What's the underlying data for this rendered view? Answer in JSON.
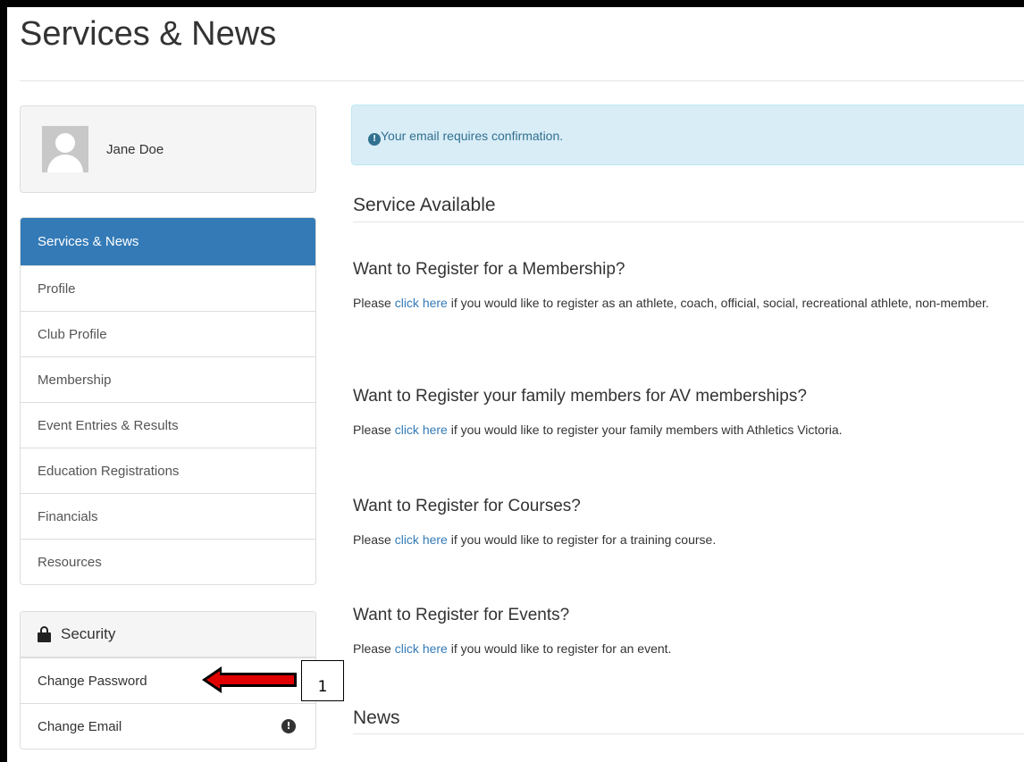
{
  "page_title": "Services & News",
  "user": {
    "name": "Jane Doe"
  },
  "nav": {
    "items": [
      {
        "label": "Services & News",
        "active": true
      },
      {
        "label": "Profile"
      },
      {
        "label": "Club Profile"
      },
      {
        "label": "Membership"
      },
      {
        "label": "Event Entries & Results"
      },
      {
        "label": "Education Registrations"
      },
      {
        "label": "Financials"
      },
      {
        "label": "Resources"
      }
    ]
  },
  "security": {
    "heading": "Security",
    "icon": "lock-icon",
    "items": [
      {
        "label": "Change Password"
      },
      {
        "label": "Change Email",
        "icon": "info-circle-icon"
      }
    ]
  },
  "annotation": {
    "callout_number": "1"
  },
  "alert": {
    "icon": "info-circle-icon",
    "text": "Your email requires confirmation."
  },
  "main": {
    "service_heading": "Service Available",
    "services": [
      {
        "title": "Want to Register for a Membership?",
        "prefix": "Please ",
        "link": "click here",
        "suffix": " if you would like to register as an athlete, coach, official, social, recreational athlete, non-member."
      },
      {
        "title": "Want to Register your family members for AV memberships?",
        "prefix": "Please ",
        "link": "click here",
        "suffix": " if you would like to register your family members with Athletics Victoria."
      },
      {
        "title": "Want to Register for Courses?",
        "prefix": "Please ",
        "link": "click here",
        "suffix": " if you would like to register for a training course."
      },
      {
        "title": "Want to Register for Events?",
        "prefix": "Please ",
        "link": "click here",
        "suffix": " if you would like to register for an event."
      }
    ],
    "news_heading": "News"
  },
  "colors": {
    "primary": "#337ab7",
    "alert_bg": "#d9edf7",
    "alert_text": "#31708f",
    "arrow": "#e00000"
  }
}
